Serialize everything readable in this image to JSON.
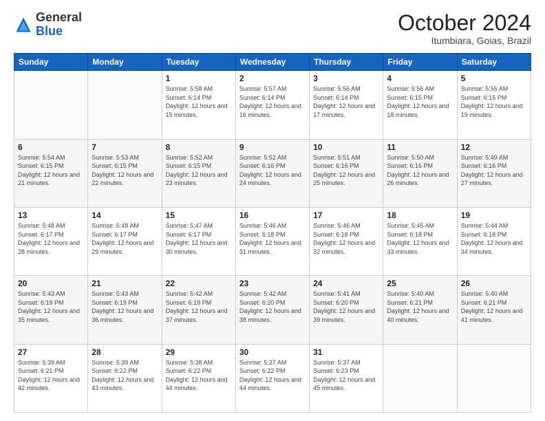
{
  "header": {
    "logo_general": "General",
    "logo_blue": "Blue",
    "month_title": "October 2024",
    "location": "Itumbiara, Goias, Brazil"
  },
  "days_of_week": [
    "Sunday",
    "Monday",
    "Tuesday",
    "Wednesday",
    "Thursday",
    "Friday",
    "Saturday"
  ],
  "weeks": [
    [
      {
        "day": "",
        "sunrise": "",
        "sunset": "",
        "daylight": ""
      },
      {
        "day": "",
        "sunrise": "",
        "sunset": "",
        "daylight": ""
      },
      {
        "day": "1",
        "sunrise": "Sunrise: 5:58 AM",
        "sunset": "Sunset: 6:14 PM",
        "daylight": "Daylight: 12 hours and 15 minutes."
      },
      {
        "day": "2",
        "sunrise": "Sunrise: 5:57 AM",
        "sunset": "Sunset: 6:14 PM",
        "daylight": "Daylight: 12 hours and 16 minutes."
      },
      {
        "day": "3",
        "sunrise": "Sunrise: 5:56 AM",
        "sunset": "Sunset: 6:14 PM",
        "daylight": "Daylight: 12 hours and 17 minutes."
      },
      {
        "day": "4",
        "sunrise": "Sunrise: 5:56 AM",
        "sunset": "Sunset: 6:15 PM",
        "daylight": "Daylight: 12 hours and 18 minutes."
      },
      {
        "day": "5",
        "sunrise": "Sunrise: 5:55 AM",
        "sunset": "Sunset: 6:15 PM",
        "daylight": "Daylight: 12 hours and 19 minutes."
      }
    ],
    [
      {
        "day": "6",
        "sunrise": "Sunrise: 5:54 AM",
        "sunset": "Sunset: 6:15 PM",
        "daylight": "Daylight: 12 hours and 21 minutes."
      },
      {
        "day": "7",
        "sunrise": "Sunrise: 5:53 AM",
        "sunset": "Sunset: 6:15 PM",
        "daylight": "Daylight: 12 hours and 22 minutes."
      },
      {
        "day": "8",
        "sunrise": "Sunrise: 5:52 AM",
        "sunset": "Sunset: 6:15 PM",
        "daylight": "Daylight: 12 hours and 23 minutes."
      },
      {
        "day": "9",
        "sunrise": "Sunrise: 5:52 AM",
        "sunset": "Sunset: 6:16 PM",
        "daylight": "Daylight: 12 hours and 24 minutes."
      },
      {
        "day": "10",
        "sunrise": "Sunrise: 5:51 AM",
        "sunset": "Sunset: 6:16 PM",
        "daylight": "Daylight: 12 hours and 25 minutes."
      },
      {
        "day": "11",
        "sunrise": "Sunrise: 5:50 AM",
        "sunset": "Sunset: 6:16 PM",
        "daylight": "Daylight: 12 hours and 26 minutes."
      },
      {
        "day": "12",
        "sunrise": "Sunrise: 5:49 AM",
        "sunset": "Sunset: 6:16 PM",
        "daylight": "Daylight: 12 hours and 27 minutes."
      }
    ],
    [
      {
        "day": "13",
        "sunrise": "Sunrise: 5:48 AM",
        "sunset": "Sunset: 6:17 PM",
        "daylight": "Daylight: 12 hours and 28 minutes."
      },
      {
        "day": "14",
        "sunrise": "Sunrise: 5:48 AM",
        "sunset": "Sunset: 6:17 PM",
        "daylight": "Daylight: 12 hours and 29 minutes."
      },
      {
        "day": "15",
        "sunrise": "Sunrise: 5:47 AM",
        "sunset": "Sunset: 6:17 PM",
        "daylight": "Daylight: 12 hours and 30 minutes."
      },
      {
        "day": "16",
        "sunrise": "Sunrise: 5:46 AM",
        "sunset": "Sunset: 6:18 PM",
        "daylight": "Daylight: 12 hours and 31 minutes."
      },
      {
        "day": "17",
        "sunrise": "Sunrise: 5:46 AM",
        "sunset": "Sunset: 6:18 PM",
        "daylight": "Daylight: 12 hours and 32 minutes."
      },
      {
        "day": "18",
        "sunrise": "Sunrise: 5:45 AM",
        "sunset": "Sunset: 6:18 PM",
        "daylight": "Daylight: 12 hours and 33 minutes."
      },
      {
        "day": "19",
        "sunrise": "Sunrise: 5:44 AM",
        "sunset": "Sunset: 6:18 PM",
        "daylight": "Daylight: 12 hours and 34 minutes."
      }
    ],
    [
      {
        "day": "20",
        "sunrise": "Sunrise: 5:43 AM",
        "sunset": "Sunset: 6:19 PM",
        "daylight": "Daylight: 12 hours and 35 minutes."
      },
      {
        "day": "21",
        "sunrise": "Sunrise: 5:43 AM",
        "sunset": "Sunset: 6:19 PM",
        "daylight": "Daylight: 12 hours and 36 minutes."
      },
      {
        "day": "22",
        "sunrise": "Sunrise: 5:42 AM",
        "sunset": "Sunset: 6:19 PM",
        "daylight": "Daylight: 12 hours and 37 minutes."
      },
      {
        "day": "23",
        "sunrise": "Sunrise: 5:42 AM",
        "sunset": "Sunset: 6:20 PM",
        "daylight": "Daylight: 12 hours and 38 minutes."
      },
      {
        "day": "24",
        "sunrise": "Sunrise: 5:41 AM",
        "sunset": "Sunset: 6:20 PM",
        "daylight": "Daylight: 12 hours and 39 minutes."
      },
      {
        "day": "25",
        "sunrise": "Sunrise: 5:40 AM",
        "sunset": "Sunset: 6:21 PM",
        "daylight": "Daylight: 12 hours and 40 minutes."
      },
      {
        "day": "26",
        "sunrise": "Sunrise: 5:40 AM",
        "sunset": "Sunset: 6:21 PM",
        "daylight": "Daylight: 12 hours and 41 minutes."
      }
    ],
    [
      {
        "day": "27",
        "sunrise": "Sunrise: 5:39 AM",
        "sunset": "Sunset: 6:21 PM",
        "daylight": "Daylight: 12 hours and 42 minutes."
      },
      {
        "day": "28",
        "sunrise": "Sunrise: 5:39 AM",
        "sunset": "Sunset: 6:22 PM",
        "daylight": "Daylight: 12 hours and 43 minutes."
      },
      {
        "day": "29",
        "sunrise": "Sunrise: 5:38 AM",
        "sunset": "Sunset: 6:22 PM",
        "daylight": "Daylight: 12 hours and 44 minutes."
      },
      {
        "day": "30",
        "sunrise": "Sunrise: 5:37 AM",
        "sunset": "Sunset: 6:22 PM",
        "daylight": "Daylight: 12 hours and 44 minutes."
      },
      {
        "day": "31",
        "sunrise": "Sunrise: 5:37 AM",
        "sunset": "Sunset: 6:23 PM",
        "daylight": "Daylight: 12 hours and 45 minutes."
      },
      {
        "day": "",
        "sunrise": "",
        "sunset": "",
        "daylight": ""
      },
      {
        "day": "",
        "sunrise": "",
        "sunset": "",
        "daylight": ""
      }
    ]
  ]
}
